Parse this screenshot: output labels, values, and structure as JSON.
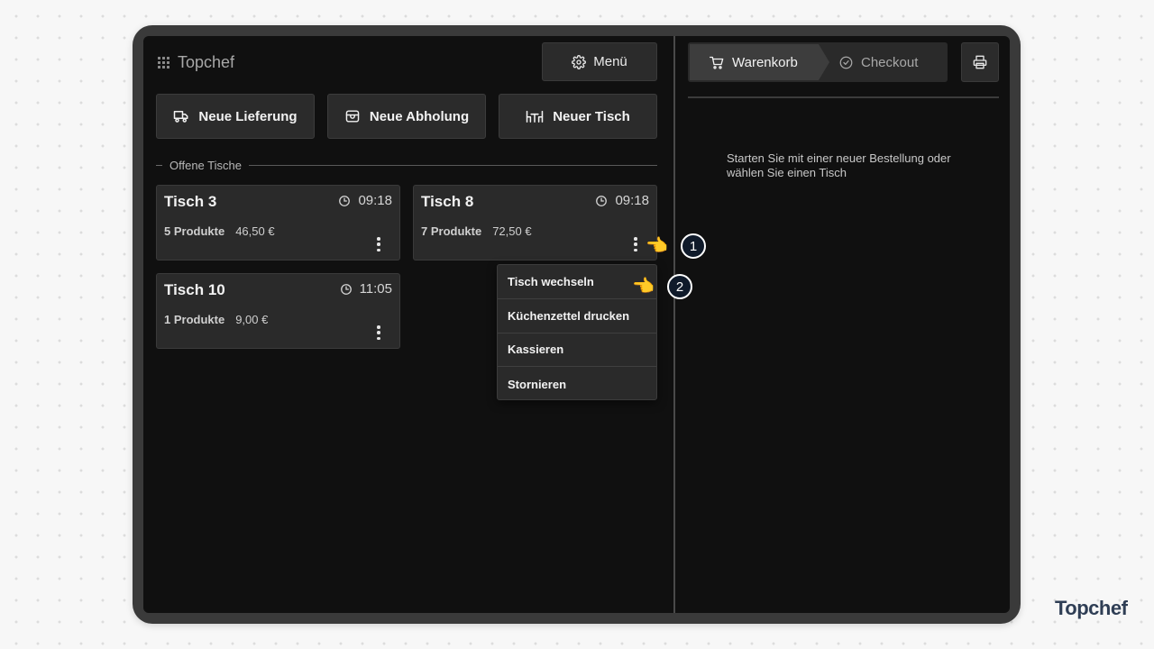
{
  "app": {
    "name": "Topchef"
  },
  "header": {
    "menu_label": "Menü"
  },
  "actions": [
    {
      "label": "Neue Lieferung",
      "icon": "delivery-truck-icon"
    },
    {
      "label": "Neue Abholung",
      "icon": "store-icon"
    },
    {
      "label": "Neuer Tisch",
      "icon": "dining-table-icon"
    }
  ],
  "section": {
    "open_tables_label": "Offene Tische"
  },
  "tables": [
    {
      "name": "Tisch 3",
      "time": "09:18",
      "products": "5 Produkte",
      "price": "46,50 €"
    },
    {
      "name": "Tisch 8",
      "time": "09:18",
      "products": "7 Produkte",
      "price": "72,50 €"
    },
    {
      "name": "Tisch 10",
      "time": "11:05",
      "products": "1 Produkte",
      "price": "9,00 €"
    }
  ],
  "context_menu": {
    "items": [
      "Tisch wechseln",
      "Küchenzettel drucken",
      "Kassieren",
      "Stornieren"
    ]
  },
  "cart": {
    "tabs": [
      {
        "label": "Warenkorb",
        "icon": "shopping-cart-icon",
        "active": true
      },
      {
        "label": "Checkout",
        "icon": "check-circle-icon",
        "active": false
      }
    ],
    "empty_message": "Starten Sie mit einer neuer Bestellung oder wählen Sie einen Tisch"
  },
  "annotations": {
    "step1": "1",
    "step2": "2"
  },
  "watermark": {
    "brand": "Topchef"
  },
  "colors": {
    "screen_bg": "#101010",
    "card_bg": "#2a2a2a",
    "accent_marker": "#0f1a2a",
    "watermark": "#2f3e55"
  }
}
